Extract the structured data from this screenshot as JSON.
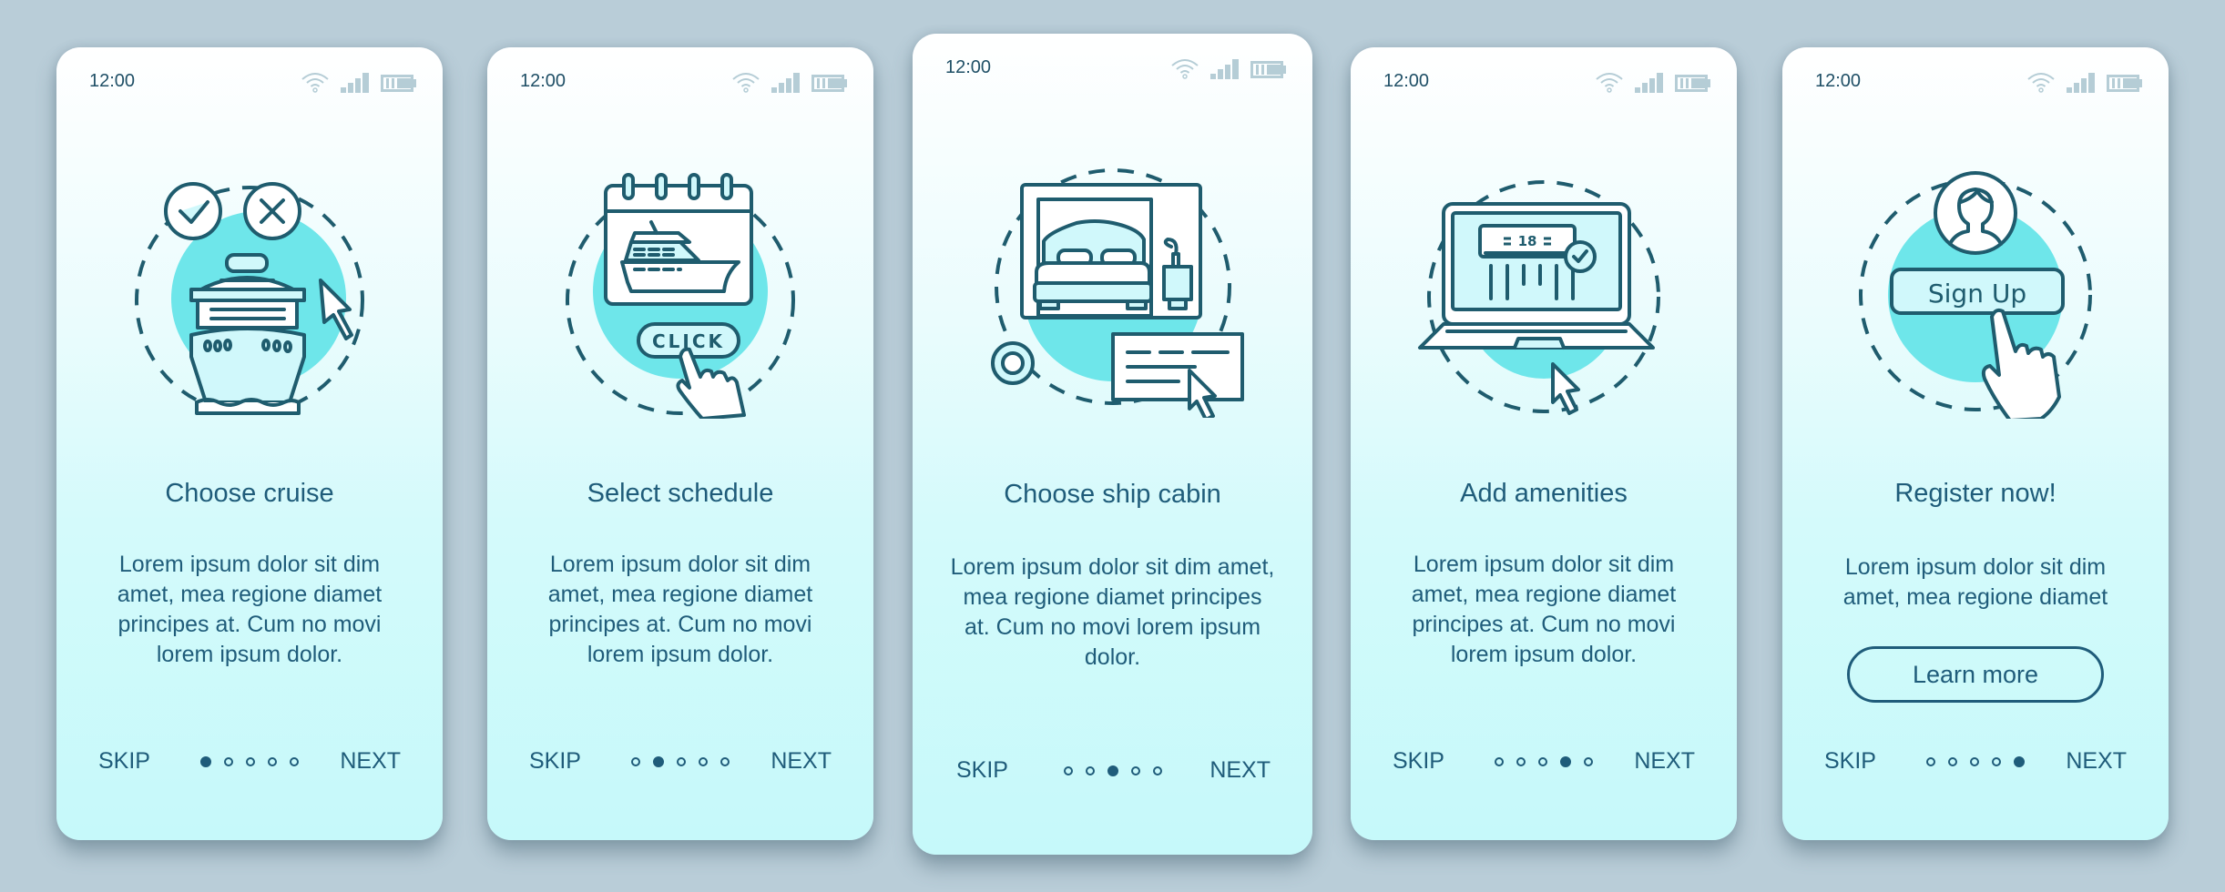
{
  "colors": {
    "background": "#b9cdd8",
    "text": "#1f5c7a",
    "accent": "#6ee6ea",
    "status_icons": "#b5cdd6"
  },
  "status": {
    "time": "12:00"
  },
  "screens": [
    {
      "title": "Choose cruise",
      "illustration": "cruise-ship-choice-icon",
      "body": "Lorem ipsum dolor sit dim amet, mea regione diamet principes at. Cum no movi lorem ipsum dolor.",
      "skip": "SKIP",
      "next": "NEXT",
      "active_step": 1,
      "total_steps": 5
    },
    {
      "title": "Select schedule",
      "illustration": "calendar-ship-click-icon",
      "illustration_label": "CLICK",
      "body": "Lorem ipsum dolor sit dim amet, mea regione diamet principes at. Cum no movi lorem ipsum dolor.",
      "skip": "SKIP",
      "next": "NEXT",
      "active_step": 2,
      "total_steps": 5
    },
    {
      "title": "Choose ship cabin",
      "illustration": "ship-cabin-bed-icon",
      "body": "Lorem ipsum dolor sit dim amet, mea regione diamet principes at. Cum no movi lorem ipsum dolor.",
      "skip": "SKIP",
      "next": "NEXT",
      "active_step": 3,
      "total_steps": 5
    },
    {
      "title": "Add amenities",
      "illustration": "laptop-air-conditioner-icon",
      "illustration_label": "18",
      "body": "Lorem ipsum dolor sit dim amet, mea regione diamet principes at. Cum no movi lorem ipsum dolor.",
      "skip": "SKIP",
      "next": "NEXT",
      "active_step": 4,
      "total_steps": 5
    },
    {
      "title": "Register now!",
      "illustration": "sign-up-user-icon",
      "illustration_label": "Sign Up",
      "body": "Lorem ipsum dolor sit dim amet, mea regione diamet",
      "button": "Learn more",
      "skip": "SKIP",
      "next": "NEXT",
      "active_step": 5,
      "total_steps": 5
    }
  ]
}
